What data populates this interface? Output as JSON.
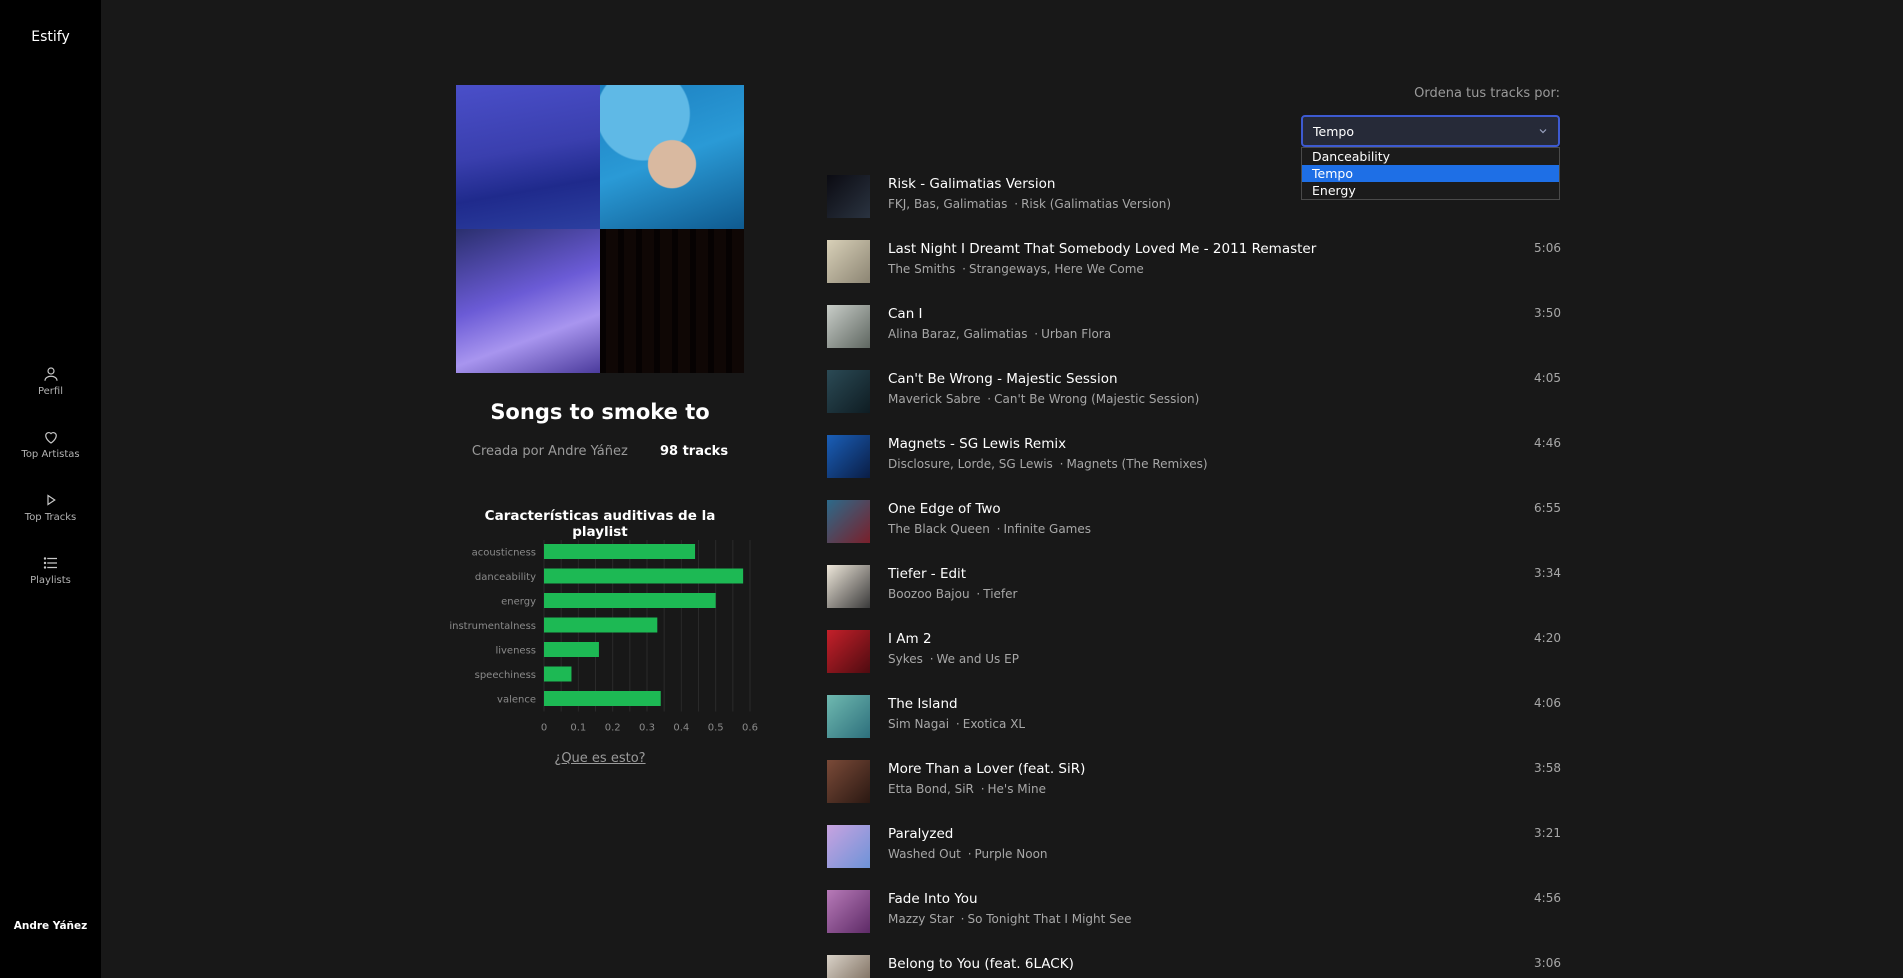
{
  "app": {
    "brand": "Estify",
    "user": "Andre Yáñez"
  },
  "nav": [
    {
      "label": "Perfil",
      "icon": "person-icon"
    },
    {
      "label": "Top Artistas",
      "icon": "heart-icon"
    },
    {
      "label": "Top Tracks",
      "icon": "play-icon"
    },
    {
      "label": "Playlists",
      "icon": "list-icon"
    }
  ],
  "playlist": {
    "title": "Songs to smoke to",
    "created_by": "Creada por Andre Yáñez",
    "tracks_count": "98 tracks",
    "features_title": "Características auditivas de la playlist",
    "what_link": "¿Que es esto?"
  },
  "sort": {
    "label": "Ordena tus tracks por:",
    "selected": "Tempo",
    "options": [
      "Danceability",
      "Tempo",
      "Energy"
    ],
    "highlighted_index": 1
  },
  "colors": {
    "accent_green": "#1db954",
    "select_border": "#3d5ad1",
    "option_highlight": "#1e6fe6"
  },
  "chart_data": {
    "type": "bar",
    "orientation": "horizontal",
    "categories": [
      "acousticness",
      "danceability",
      "energy",
      "instrumentalness",
      "liveness",
      "speechiness",
      "valence"
    ],
    "values": [
      0.44,
      0.58,
      0.5,
      0.33,
      0.16,
      0.08,
      0.34
    ],
    "xlim": [
      0,
      0.6
    ],
    "xticks": [
      "0",
      "0.1",
      "0.2",
      "0.3",
      "0.4",
      "0.5",
      "0.6"
    ],
    "grid": true,
    "color": "#1db954"
  },
  "tracks": [
    {
      "name": "Risk - Galimatias Version",
      "artists": "FKJ, Bas, Galimatias",
      "album": "Risk (Galimatias Version)",
      "duration": "",
      "art": [
        "#0b0b12",
        "#2a3340"
      ]
    },
    {
      "name": "Last Night I Dreamt That Somebody Loved Me - 2011 Remaster",
      "artists": "The Smiths",
      "album": "Strangeways, Here We Come",
      "duration": "5:06",
      "art": [
        "#d8d0b8",
        "#8c8573"
      ]
    },
    {
      "name": "Can I",
      "artists": "Alina Baraz, Galimatias",
      "album": "Urban Flora",
      "duration": "3:50",
      "art": [
        "#c8cdc8",
        "#5e6660"
      ]
    },
    {
      "name": "Can't Be Wrong - Majestic Session",
      "artists": "Maverick Sabre",
      "album": "Can't Be Wrong (Majestic Session)",
      "duration": "4:05",
      "art": [
        "#2b4a55",
        "#0e1c22"
      ]
    },
    {
      "name": "Magnets - SG Lewis Remix",
      "artists": "Disclosure, Lorde, SG Lewis",
      "album": "Magnets (The Remixes)",
      "duration": "4:46",
      "art": [
        "#1a5fb8",
        "#0a1d45"
      ]
    },
    {
      "name": "One Edge of Two",
      "artists": "The Black Queen",
      "album": "Infinite Games",
      "duration": "6:55",
      "art": [
        "#2c6a8a",
        "#7a1f2a"
      ]
    },
    {
      "name": "Tiefer - Edit",
      "artists": "Boozoo Bajou",
      "album": "Tiefer",
      "duration": "3:34",
      "art": [
        "#eee7da",
        "#3a3a3a"
      ]
    },
    {
      "name": "I Am 2",
      "artists": "Sykes",
      "album": "We and Us EP",
      "duration": "4:20",
      "art": [
        "#c4202a",
        "#4e0b10"
      ]
    },
    {
      "name": "The Island",
      "artists": "Sim Nagai",
      "album": "Exotica XL",
      "duration": "4:06",
      "art": [
        "#6fb9b0",
        "#2d6f7c"
      ]
    },
    {
      "name": "More Than a Lover (feat. SiR)",
      "artists": "Etta Bond, SiR",
      "album": "He's Mine",
      "duration": "3:58",
      "art": [
        "#7a4a38",
        "#2a1812"
      ]
    },
    {
      "name": "Paralyzed",
      "artists": "Washed Out",
      "album": "Purple Noon",
      "duration": "3:21",
      "art": [
        "#c8a3e0",
        "#6d93d8"
      ]
    },
    {
      "name": "Fade Into You",
      "artists": "Mazzy Star",
      "album": "So Tonight That I Might See",
      "duration": "4:56",
      "art": [
        "#b77ab8",
        "#5d2a66"
      ]
    },
    {
      "name": "Belong to You (feat. 6LACK)",
      "artists": "",
      "album": "",
      "duration": "3:06",
      "art": [
        "#d9d2c8",
        "#6b5a4a"
      ]
    }
  ]
}
